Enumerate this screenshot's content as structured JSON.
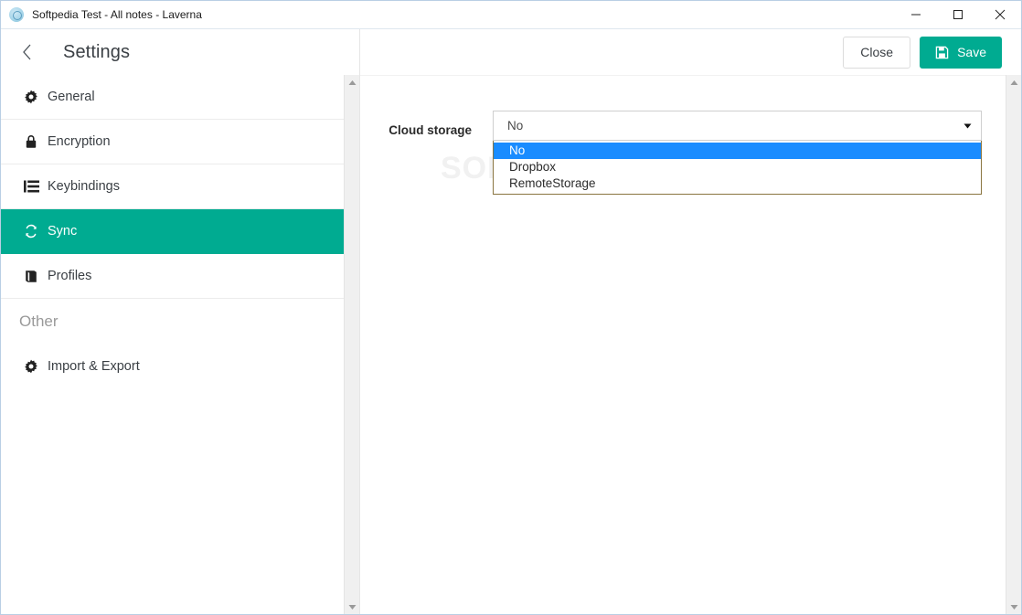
{
  "window": {
    "title": "Softpedia Test - All notes - Laverna",
    "app_icon": "laverna-app-icon",
    "controls": {
      "minimize": "minimize-icon",
      "maximize": "maximize-icon",
      "close": "close-icon"
    }
  },
  "header": {
    "back_icon": "chevron-left-icon",
    "title": "Settings",
    "close_label": "Close",
    "save_label": "Save",
    "save_icon": "floppy-save-icon"
  },
  "sidebar": {
    "items": [
      {
        "label": "General",
        "icon": "gear-icon",
        "active": false
      },
      {
        "label": "Encryption",
        "icon": "lock-icon",
        "active": false
      },
      {
        "label": "Keybindings",
        "icon": "keyboard-list-icon",
        "active": false
      },
      {
        "label": "Sync",
        "icon": "refresh-sync-icon",
        "active": true
      },
      {
        "label": "Profiles",
        "icon": "book-icon",
        "active": false
      }
    ],
    "section_label": "Other",
    "other_items": [
      {
        "label": "Import & Export",
        "icon": "gear-icon",
        "active": false
      }
    ],
    "scroll_up_icon": "scroll-up-arrow-icon",
    "scroll_down_icon": "scroll-down-arrow-icon"
  },
  "main": {
    "watermark": "SOFTPEDIA",
    "watermark_mark": "®",
    "form": {
      "label": "Cloud storage",
      "select_value": "No",
      "caret_icon": "dropdown-caret-icon",
      "options": [
        {
          "label": "No",
          "selected": true
        },
        {
          "label": "Dropbox",
          "selected": false
        },
        {
          "label": "RemoteStorage",
          "selected": false
        }
      ]
    }
  },
  "colors": {
    "accent_teal": "#00ab91",
    "dropdown_highlight": "#1a8cff",
    "dropdown_border": "#8a7540",
    "text_primary": "#3a3f44",
    "section_text": "#9a9a9a",
    "window_border": "#b9cfe4"
  }
}
